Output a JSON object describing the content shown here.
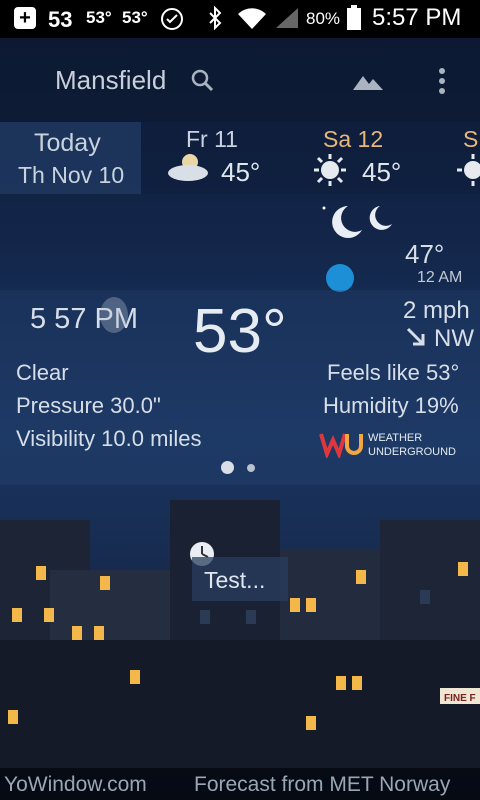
{
  "status_bar": {
    "temp_1": "53",
    "temp_2": "53°",
    "temp_3": "53°",
    "battery": "80%",
    "time": "5:57 PM"
  },
  "toolbar": {
    "city": "Mansfield"
  },
  "forecast": [
    {
      "day": "Today",
      "date": "Th Nov 10"
    },
    {
      "day": "Fr 11",
      "temp": "45°"
    },
    {
      "day": "Sa 12",
      "temp": "45°"
    },
    {
      "day": "S"
    }
  ],
  "timeline": {
    "temp": "47°",
    "time": "12 AM"
  },
  "current": {
    "time": "5 57 PM",
    "temp": "53°",
    "wind_speed": "2 mph",
    "wind_dir": "NW",
    "condition": "Clear",
    "feels_like": "Feels like 53°",
    "pressure": "Pressure 30.0\"",
    "humidity": "Humidity 19%",
    "visibility": "Visibility 10.0 miles"
  },
  "brand": {
    "line1": "WEATHER",
    "line2": "UNDERGROUND"
  },
  "scene": {
    "test_label": "Test...",
    "shop_sign": "FINE F"
  },
  "footer": {
    "left": "YoWindow.com",
    "right": "Forecast from MET Norway"
  },
  "colors": {
    "accent_blue": "#1c8fd6",
    "window_light": "#f4b84a"
  }
}
